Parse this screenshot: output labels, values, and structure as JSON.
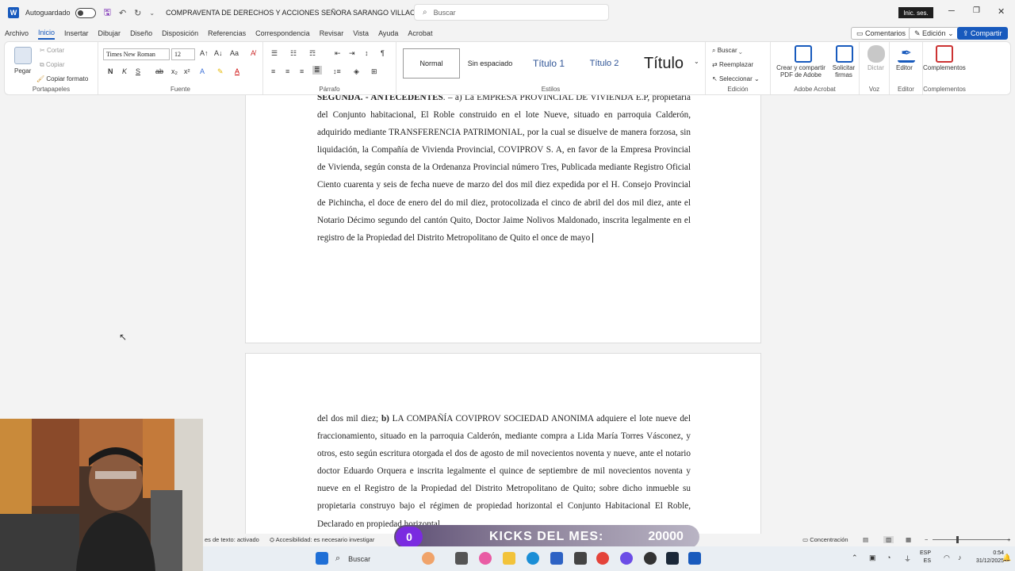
{
  "titlebar": {
    "app_icon": "W",
    "autosave_label": "Autoguardado",
    "document_title": "COMPRAVENTA DE DERECHOS Y ACCIONES SEÑORA SARANGO VILLACIS",
    "search_placeholder": "Buscar",
    "signin_label": "Inic. ses.",
    "minimize": "─",
    "restore": "❐",
    "close": "✕"
  },
  "menu": {
    "tabs": [
      "Archivo",
      "Inicio",
      "Insertar",
      "Dibujar",
      "Diseño",
      "Disposición",
      "Referencias",
      "Correspondencia",
      "Revisar",
      "Vista",
      "Ayuda",
      "Acrobat"
    ],
    "comments_label": "Comentarios",
    "edit_label": "Edición",
    "share_label": "Compartir"
  },
  "ribbon": {
    "clipboard": {
      "paste": "Pegar",
      "cut": "Cortar",
      "copy": "Copiar",
      "format_painter": "Copiar formato",
      "label": "Portapapeles"
    },
    "font": {
      "family": "Times New Roman",
      "size": "12",
      "label": "Fuente",
      "bold": "N",
      "italic": "K",
      "underline": "S"
    },
    "paragraph": {
      "label": "Párrafo"
    },
    "styles": {
      "items": [
        "Normal",
        "Sin espaciado",
        "Título 1",
        "Título 2",
        "Título"
      ],
      "label": "Estilos"
    },
    "editing": {
      "find": "Buscar",
      "replace": "Reemplazar",
      "select": "Seleccionar",
      "label": "Edición"
    },
    "adobe": {
      "create_share": "Crear y compartir PDF de Adobe",
      "request_signatures": "Solicitar firmas",
      "label": "Adobe Acrobat"
    },
    "voice": {
      "dictate": "Dictar",
      "label": "Voz"
    },
    "editor": {
      "button": "Editor",
      "label": "Editor"
    },
    "addins": {
      "button": "Complementos",
      "label": "Complementos"
    }
  },
  "document": {
    "page1_lines": [
      {
        "bold": "SEGUNDA. - ANTECEDENTES",
        "text": ". – a) La EMPRESA PROVINCIAL DE VIVIENDA E.P, propietaria del Conjunto habitacional, El Roble construido en el lote Nueve, situado en parroquia Calderón, adquirido mediante TRANSFERENCIA PATRIMONIAL, por la cual se disuelve de manera forzosa, sin liquidación, la Compañía de Vivienda Provincial, COVIPROV S. A, en favor de la Empresa Provincial de Vivienda, según consta de la Ordenanza Provincial número Tres, Publicada mediante Registro Oficial Ciento cuarenta y seis de fecha nueve de marzo del dos mil diez expedida por el H. Consejo Provincial de Pichincha, el doce de enero del do mil diez, protocolizada el cinco de abril del dos mil diez, ante el Notario Décimo segundo del cantón Quito, Doctor Jaime Nolivos Maldonado, inscrita legalmente en el registro de la Propiedad del Distrito Metropolitano de Quito el once de mayo"
      }
    ],
    "page2_prefix": "del dos mil diez; ",
    "page2_bold": "b)",
    "page2_text": " LA COMPAÑÍA COVIPROV SOCIEDAD ANONIMA adquiere el lote nueve del fraccionamiento, situado en la parroquia Calderón, mediante compra a Lida María Torres Vásconez, y otros, esto según escritura otorgada el dos de agosto de mil novecientos noventa y nueve, ante el notario doctor Eduardo Orquera e inscrita legalmente el quince de septiembre de mil novecientos noventa y nueve en el Registro de la Propiedad del Distrito Metropolitano de Quito; sobre dicho inmueble su propietaria construyo bajo el régimen de propiedad horizontal el Conjunto Habitacional El Roble, Declarado en propiedad horizontal"
  },
  "statusbar": {
    "text_prediction": "es de texto: activado",
    "accessibility": "Accesibilidad: es necesario investigar",
    "focus": "Concentración"
  },
  "overlay": {
    "kicks_count": "0",
    "kicks_label": "KICKS DEL MES:",
    "kicks_value": "20000"
  },
  "taskbar": {
    "search_label": "Buscar",
    "lang_top": "ESP",
    "lang_bottom": "ES",
    "time": "0:54",
    "date": "31/12/2025"
  },
  "colors": {
    "accent": "#185abd",
    "kicks_badge": "#7a2be0"
  }
}
